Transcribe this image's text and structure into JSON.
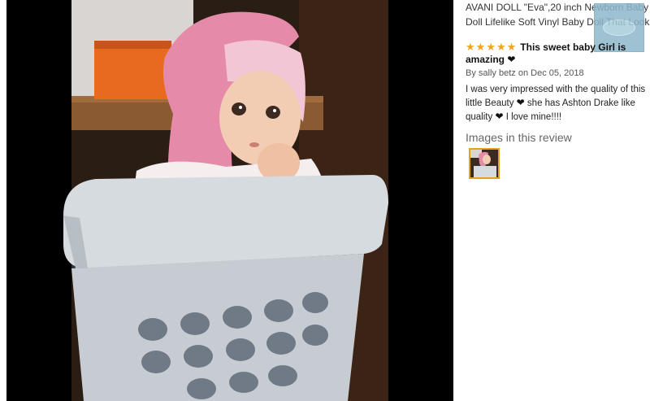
{
  "product": {
    "title_line1": "AVANI DOLL \"Eva\",20 inch Newborn Baby",
    "title_line2": "Doll Lifelike Soft Vinyl Baby Doll That Looks"
  },
  "review": {
    "rating": 5,
    "rating_max": 5,
    "headline_part1": "This sweet baby Girl is",
    "headline_part2": "amazing",
    "byline_prefix": "By",
    "author": "sally betz",
    "date_prefix": "on",
    "date": "Dec 05, 2018",
    "body_line1": "I was very impressed with the quality of this",
    "body_line2_a": "little Beauty",
    "body_line2_b": "she has Ashton Drake like",
    "body_line3_a": "quality",
    "body_line3_b": "I love mine!!!!"
  },
  "images_section": {
    "heading": "Images in this review"
  },
  "colors": {
    "star": "#f0a41a",
    "thumb_border": "#e3a21a",
    "photo_bg": "#000000"
  },
  "icons": {
    "star": "star-icon",
    "heart": "heart-icon"
  }
}
